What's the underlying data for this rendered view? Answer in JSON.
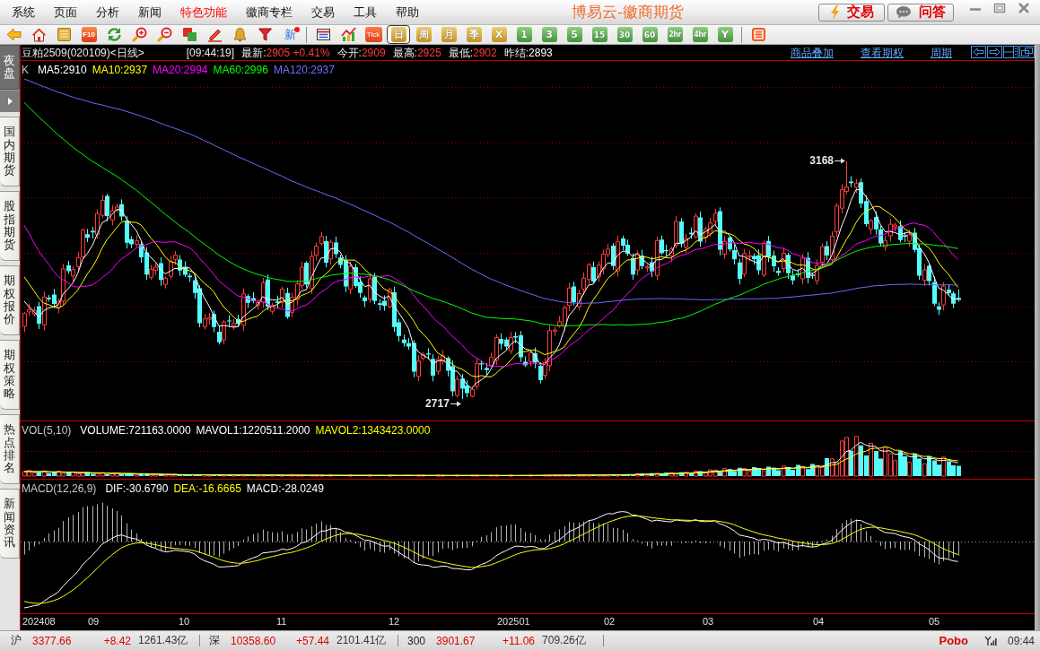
{
  "menu_bar": {
    "items": [
      {
        "label": "系统",
        "highlight": false
      },
      {
        "label": "页面",
        "highlight": false
      },
      {
        "label": "分析",
        "highlight": false
      },
      {
        "label": "新闻",
        "highlight": false
      },
      {
        "label": "特色功能",
        "highlight": true
      },
      {
        "label": "徽商专栏",
        "highlight": false
      },
      {
        "label": "交易",
        "highlight": false
      },
      {
        "label": "工具",
        "highlight": false
      },
      {
        "label": "帮助",
        "highlight": false
      }
    ],
    "title": "博易云-徽商期货",
    "buttons": [
      {
        "kind": "trade",
        "label": "交易"
      },
      {
        "kind": "ask",
        "label": "问答"
      }
    ]
  },
  "toolbar": {
    "f10_label": "F10",
    "news_label": "新",
    "tick_label": "Tick",
    "periods": [
      {
        "label": "日",
        "kind": "calendar",
        "selected": true
      },
      {
        "label": "周",
        "kind": "calendar",
        "selected": false
      },
      {
        "label": "月",
        "kind": "calendar",
        "selected": false
      },
      {
        "label": "季",
        "kind": "calendar",
        "selected": false
      },
      {
        "label": "X",
        "kind": "calendar",
        "selected": false
      },
      {
        "label": "1",
        "kind": "minute",
        "selected": false
      },
      {
        "label": "3",
        "kind": "minute",
        "selected": false
      },
      {
        "label": "5",
        "kind": "minute",
        "selected": false
      },
      {
        "label": "15",
        "kind": "minute",
        "selected": false
      },
      {
        "label": "30",
        "kind": "minute",
        "selected": false
      },
      {
        "label": "60",
        "kind": "minute",
        "selected": false
      },
      {
        "label": "2hr",
        "kind": "minute",
        "selected": false
      },
      {
        "label": "4hr",
        "kind": "minute",
        "selected": false
      },
      {
        "label": "Y",
        "kind": "minute",
        "selected": false
      }
    ]
  },
  "side_tabs": [
    {
      "label": "夜盘",
      "selected": true
    },
    {
      "label": "国内期货",
      "selected": false
    },
    {
      "label": "股指期货",
      "selected": false
    },
    {
      "label": "期权报价",
      "selected": false
    },
    {
      "label": "期权策略",
      "selected": false
    },
    {
      "label": "热点排名",
      "selected": false
    },
    {
      "label": "新闻资讯",
      "selected": false
    }
  ],
  "chart_header": {
    "instrument": "豆粕2509(020109)<日线>",
    "time": "[09:44:19]",
    "quotes": [
      {
        "label": "最新:",
        "value": "2905 +0.41%",
        "color": "#ff3c3c"
      },
      {
        "label": "今开:",
        "value": "2909",
        "color": "#ff3c3c"
      },
      {
        "label": "最高:",
        "value": "2925",
        "color": "#ff3c3c"
      },
      {
        "label": "最低:",
        "value": "2902",
        "color": "#ff3c3c"
      },
      {
        "label": "昨结:",
        "value": "2893",
        "color": "#ffffff"
      }
    ],
    "links": [
      "商品叠加",
      "查看期权",
      "周期"
    ]
  },
  "price_panel": {
    "indicator": "K",
    "ma": [
      {
        "label": "MA5:2910",
        "color": "#ffffff"
      },
      {
        "label": "MA10:2937",
        "color": "#ffff00"
      },
      {
        "label": "MA20:2994",
        "color": "#ff00ff"
      },
      {
        "label": "MA60:2996",
        "color": "#00ff00"
      },
      {
        "label": "MA120:2937",
        "color": "#6c6cff"
      }
    ],
    "high_label": "3168",
    "low_label": "2717"
  },
  "volume_panel": {
    "title": "VOL(5,10)",
    "values": [
      {
        "label": "VOLUME:721163.0000",
        "color": "#ffffff"
      },
      {
        "label": "MAVOL1:1220511.2000",
        "color": "#ffffff"
      },
      {
        "label": "MAVOL2:1343423.0000",
        "color": "#ffff00"
      }
    ]
  },
  "macd_panel": {
    "title": "MACD(12,26,9)",
    "values": [
      {
        "label": "DIF:-30.6790",
        "color": "#ffffff"
      },
      {
        "label": "DEA:-16.6665",
        "color": "#ffff00"
      },
      {
        "label": "MACD:-28.0249",
        "color": "#ffffff"
      }
    ]
  },
  "x_axis": {
    "labels": [
      "202408",
      "09",
      "10",
      "11",
      "12",
      "202501",
      "02",
      "03",
      "04",
      "05"
    ]
  },
  "status_bar": {
    "indices": [
      {
        "name": "沪",
        "value": "3377.66",
        "change": "+8.42",
        "amount": "1261.43亿"
      },
      {
        "name": "深",
        "value": "10358.60",
        "change": "+57.44",
        "amount": "2101.41亿"
      },
      {
        "name": "300",
        "value": "3901.67",
        "change": "+11.06",
        "amount": "709.26亿"
      }
    ],
    "brand": "Pobo",
    "time": "09:44"
  }
}
